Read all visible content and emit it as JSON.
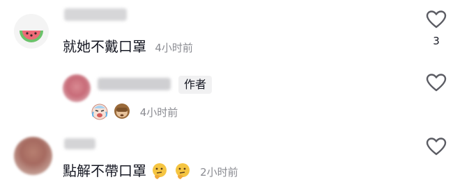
{
  "comments": [
    {
      "text": "就她不戴口罩",
      "time": "4小时前",
      "likes": "3"
    },
    {
      "badge": "作者",
      "time": "4小时前",
      "emoji_icons": [
        "crying-laughing-baby-emoji-icon",
        "see-no-evil-monkey-emoji-icon"
      ]
    },
    {
      "text": "點解不帶口罩",
      "time": "2小时前",
      "emoji_icons": [
        "thinking-face-emoji-icon",
        "thinking-face-emoji-icon"
      ]
    }
  ],
  "colors": {
    "text": "#161823",
    "secondary": "#8a8b91",
    "badge_bg": "#f1f1f2"
  }
}
